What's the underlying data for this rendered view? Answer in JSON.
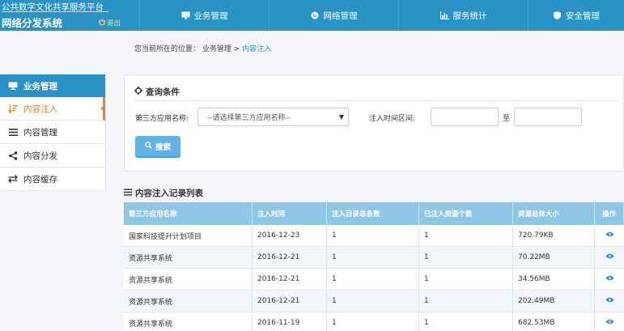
{
  "brand": {
    "subtitle": "公共数字文化共享服务平台",
    "title": "网络分发系统",
    "logout_label": "退出"
  },
  "nav": {
    "items": [
      {
        "label": "业务管理",
        "icon": "monitor-icon"
      },
      {
        "label": "网络管理",
        "icon": "globe-icon"
      },
      {
        "label": "服务统计",
        "icon": "bar-chart-icon"
      },
      {
        "label": "安全管理",
        "icon": "shield-icon"
      }
    ]
  },
  "breadcrumb": {
    "prefix": "您当前所在的位置：",
    "level1": "业务管理",
    "separator": ">",
    "current": "内容注入"
  },
  "sidebar": {
    "header": "业务管理",
    "items": [
      {
        "label": "内容注入",
        "icon": "sort-icon",
        "active": true
      },
      {
        "label": "内容管理",
        "icon": "list-icon",
        "active": false
      },
      {
        "label": "内容分发",
        "icon": "share-icon",
        "active": false
      },
      {
        "label": "内容缓存",
        "icon": "exchange-icon",
        "active": false
      }
    ]
  },
  "query": {
    "title": "查询条件",
    "app_label": "第三方应用名称:",
    "app_select_value": "--请选择第三方应用名称--",
    "time_label": "注入时间区间:",
    "to_label": "至",
    "start_value": "",
    "end_value": "",
    "search_label": "搜索"
  },
  "list": {
    "title": "内容注入记录列表",
    "columns": [
      "第三方应用名称",
      "注入时间",
      "注入目录总条数",
      "已注入资源个数",
      "资源总体大小",
      "操作"
    ],
    "rows": [
      [
        "国家科技提升计划项目",
        "2016-12-23",
        "1",
        "1",
        "720.79KB"
      ],
      [
        "资源共享系统",
        "2016-12-21",
        "1",
        "1",
        "70.22MB"
      ],
      [
        "资源共享系统",
        "2016-12-21",
        "1",
        "1",
        "34.56MB"
      ],
      [
        "资源共享系统",
        "2016-12-21",
        "1",
        "1",
        "202.49MB"
      ],
      [
        "资源共享系统",
        "2016-11-19",
        "1",
        "1",
        "682.53MB"
      ]
    ]
  },
  "colors": {
    "primary": "#2a93c6",
    "accent": "#e8842f",
    "table_header": "#8fc6e5",
    "button": "#5fb3e6"
  }
}
